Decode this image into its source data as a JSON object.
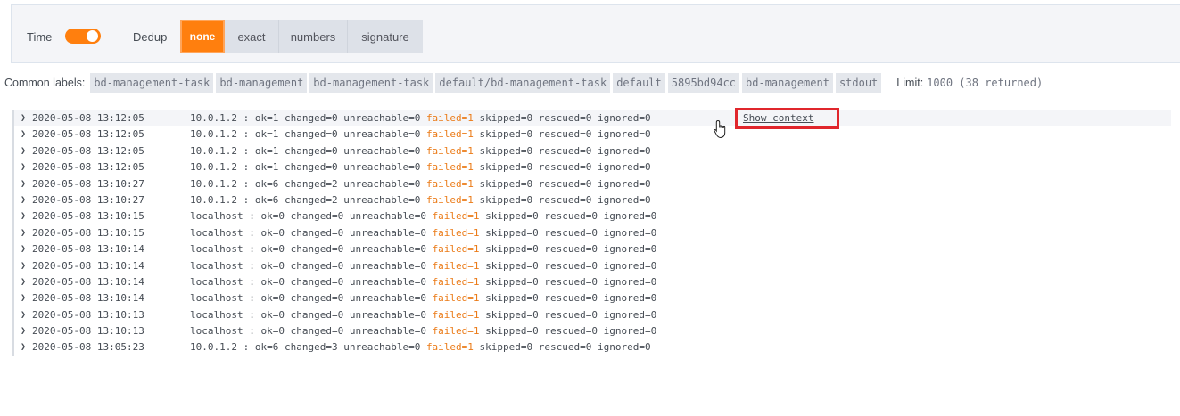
{
  "toolbar": {
    "time_label": "Time",
    "dedup_label": "Dedup",
    "dedup_options": [
      "none",
      "exact",
      "numbers",
      "signature"
    ],
    "dedup_selected": "none",
    "accent_color": "#ff7f0e"
  },
  "common_labels": {
    "title": "Common labels:",
    "labels": [
      "bd-management-task",
      "bd-management",
      "bd-management-task",
      "default/bd-management-task",
      "default",
      "5895bd94cc",
      "bd-management",
      "stdout"
    ],
    "limit_label": "Limit:",
    "limit_value": "1000 (38 returned)"
  },
  "logs": {
    "show_context": "Show context",
    "failed_color": "#eb7b18",
    "rows": [
      {
        "ts": "2020-05-08 13:12:05",
        "host": "10.0.1.2",
        "ok": "ok=1",
        "changed": "changed=0",
        "unreachable": "unreachable=0",
        "failed": "failed=1",
        "rest": "skipped=0 rescued=0 ignored=0"
      },
      {
        "ts": "2020-05-08 13:12:05",
        "host": "10.0.1.2",
        "ok": "ok=1",
        "changed": "changed=0",
        "unreachable": "unreachable=0",
        "failed": "failed=1",
        "rest": "skipped=0 rescued=0 ignored=0"
      },
      {
        "ts": "2020-05-08 13:12:05",
        "host": "10.0.1.2",
        "ok": "ok=1",
        "changed": "changed=0",
        "unreachable": "unreachable=0",
        "failed": "failed=1",
        "rest": "skipped=0 rescued=0 ignored=0"
      },
      {
        "ts": "2020-05-08 13:12:05",
        "host": "10.0.1.2",
        "ok": "ok=1",
        "changed": "changed=0",
        "unreachable": "unreachable=0",
        "failed": "failed=1",
        "rest": "skipped=0 rescued=0 ignored=0"
      },
      {
        "ts": "2020-05-08 13:10:27",
        "host": "10.0.1.2",
        "ok": "ok=6",
        "changed": "changed=2",
        "unreachable": "unreachable=0",
        "failed": "failed=1",
        "rest": "skipped=0 rescued=0 ignored=0"
      },
      {
        "ts": "2020-05-08 13:10:27",
        "host": "10.0.1.2",
        "ok": "ok=6",
        "changed": "changed=2",
        "unreachable": "unreachable=0",
        "failed": "failed=1",
        "rest": "skipped=0 rescued=0 ignored=0"
      },
      {
        "ts": "2020-05-08 13:10:15",
        "host": "localhost",
        "ok": "ok=0",
        "changed": "changed=0",
        "unreachable": "unreachable=0",
        "failed": "failed=1",
        "rest": "skipped=0 rescued=0 ignored=0"
      },
      {
        "ts": "2020-05-08 13:10:15",
        "host": "localhost",
        "ok": "ok=0",
        "changed": "changed=0",
        "unreachable": "unreachable=0",
        "failed": "failed=1",
        "rest": "skipped=0 rescued=0 ignored=0"
      },
      {
        "ts": "2020-05-08 13:10:14",
        "host": "localhost",
        "ok": "ok=0",
        "changed": "changed=0",
        "unreachable": "unreachable=0",
        "failed": "failed=1",
        "rest": "skipped=0 rescued=0 ignored=0"
      },
      {
        "ts": "2020-05-08 13:10:14",
        "host": "localhost",
        "ok": "ok=0",
        "changed": "changed=0",
        "unreachable": "unreachable=0",
        "failed": "failed=1",
        "rest": "skipped=0 rescued=0 ignored=0"
      },
      {
        "ts": "2020-05-08 13:10:14",
        "host": "localhost",
        "ok": "ok=0",
        "changed": "changed=0",
        "unreachable": "unreachable=0",
        "failed": "failed=1",
        "rest": "skipped=0 rescued=0 ignored=0"
      },
      {
        "ts": "2020-05-08 13:10:14",
        "host": "localhost",
        "ok": "ok=0",
        "changed": "changed=0",
        "unreachable": "unreachable=0",
        "failed": "failed=1",
        "rest": "skipped=0 rescued=0 ignored=0"
      },
      {
        "ts": "2020-05-08 13:10:13",
        "host": "localhost",
        "ok": "ok=0",
        "changed": "changed=0",
        "unreachable": "unreachable=0",
        "failed": "failed=1",
        "rest": "skipped=0 rescued=0 ignored=0"
      },
      {
        "ts": "2020-05-08 13:10:13",
        "host": "localhost",
        "ok": "ok=0",
        "changed": "changed=0",
        "unreachable": "unreachable=0",
        "failed": "failed=1",
        "rest": "skipped=0 rescued=0 ignored=0"
      },
      {
        "ts": "2020-05-08 13:05:23",
        "host": "10.0.1.2",
        "ok": "ok=6",
        "changed": "changed=3",
        "unreachable": "unreachable=0",
        "failed": "failed=1",
        "rest": "skipped=0 rescued=0 ignored=0"
      }
    ]
  }
}
